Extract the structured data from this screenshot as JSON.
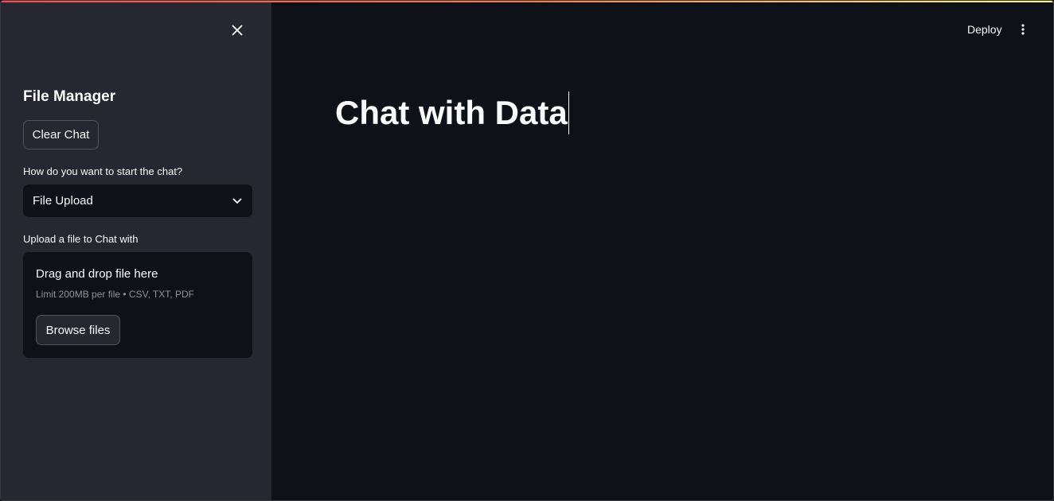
{
  "sidebar": {
    "title": "File Manager",
    "clear_button": "Clear Chat",
    "select_label": "How do you want to start the chat?",
    "select_value": "File Upload",
    "upload_label": "Upload a file to Chat with",
    "dropzone": {
      "title": "Drag and drop file here",
      "limit_text": "Limit 200MB per file • CSV, TXT, PDF",
      "browse_button": "Browse files"
    },
    "icons": {
      "close": "close-icon",
      "chevron": "chevron-down-icon"
    }
  },
  "header": {
    "deploy_label": "Deploy",
    "menu_icon": "more-vertical-icon"
  },
  "main": {
    "title": "Chat with Data"
  },
  "colors": {
    "main_background": "#0e1117",
    "sidebar_background": "#262730",
    "text": "#fafafa",
    "muted_text": "#8f919a",
    "accent_gradient_start": "#ff4b4b",
    "accent_gradient_end": "#fffd80"
  }
}
